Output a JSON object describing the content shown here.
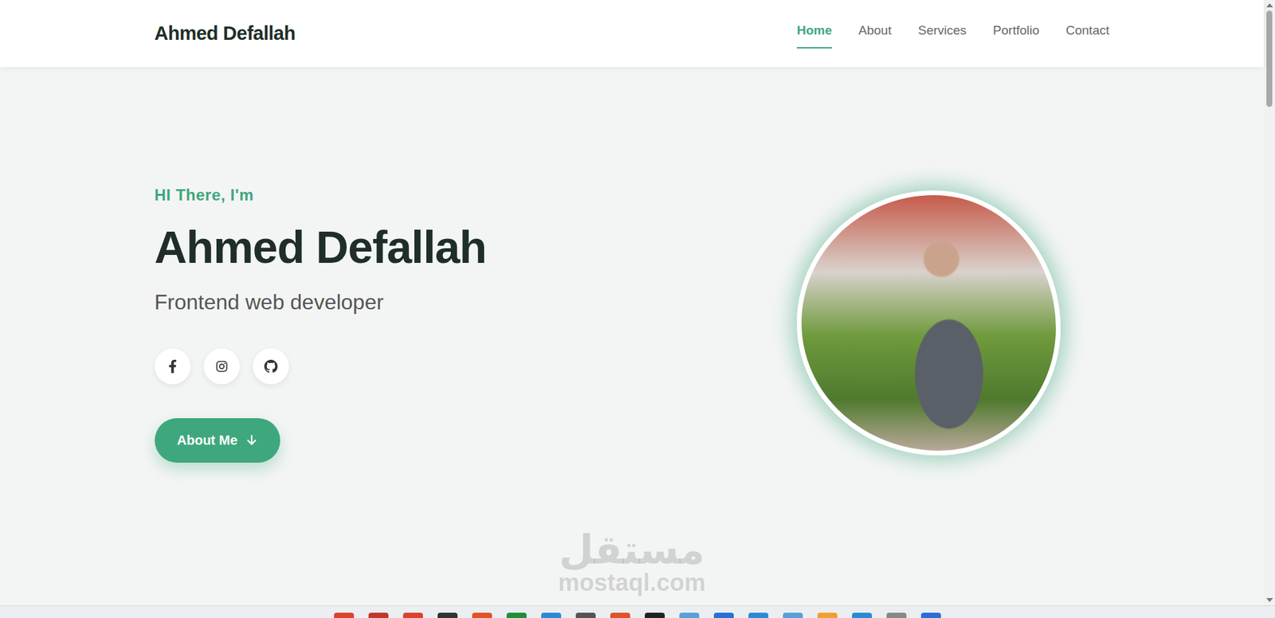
{
  "brand": "Ahmed Defallah",
  "nav": [
    {
      "label": "Home",
      "selected": true
    },
    {
      "label": "About",
      "selected": false
    },
    {
      "label": "Services",
      "selected": false
    },
    {
      "label": "Portfolio",
      "selected": false
    },
    {
      "label": "Contact",
      "selected": false
    }
  ],
  "hero": {
    "greeting": "HI There, I'm",
    "name": "Ahmed Defallah",
    "role": "Frontend web developer",
    "button": "About Me"
  },
  "social": [
    {
      "kind": "facebook"
    },
    {
      "kind": "instagram"
    },
    {
      "kind": "github"
    }
  ],
  "watermark": {
    "arabic": "مستقل",
    "latin": "mostaql.com"
  }
}
